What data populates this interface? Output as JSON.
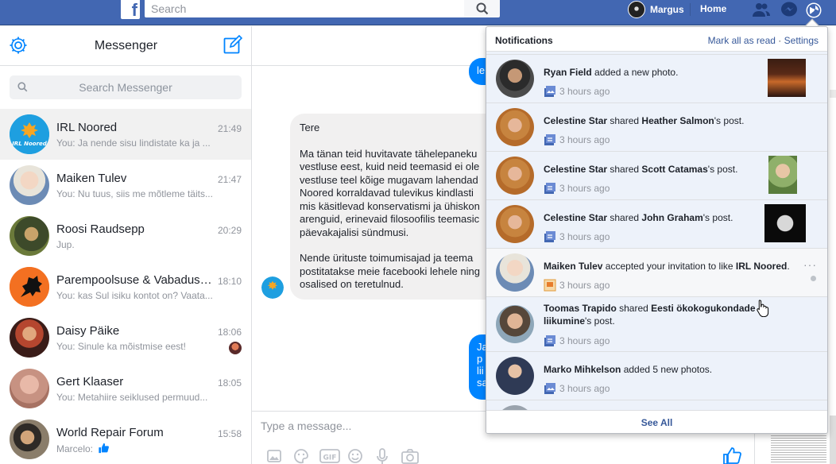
{
  "topbar": {
    "search_placeholder": "Search",
    "profile_name": "Margus",
    "home_label": "Home"
  },
  "messenger": {
    "title": "Messenger",
    "search_placeholder": "Search Messenger",
    "conversations": [
      {
        "name": "IRL Noored",
        "time": "21:49",
        "snippet": "You: Ja nende sisu lindistate ka ja ...",
        "avatar_icon": "irl-noored-logo"
      },
      {
        "name": "Maiken Tulev",
        "time": "21:47",
        "snippet": "You: Nu tuus, siis me mõtleme täits..."
      },
      {
        "name": "Roosi Raudsepp",
        "time": "20:29",
        "snippet": "Jup."
      },
      {
        "name": "Parempoolsuse & Vabaduse ...",
        "time": "18:10",
        "snippet": "You: kas Sul isiku kontot on? Vaata..."
      },
      {
        "name": "Daisy Päike",
        "time": "18:06",
        "snippet": "You: Sinule ka mõistmise eest!"
      },
      {
        "name": "Gert Klaaser",
        "time": "18:05",
        "snippet": "You: Metahiire seiklused permuud..."
      },
      {
        "name": "World Repair Forum",
        "time": "15:58",
        "snippet": "Marcelo:"
      }
    ]
  },
  "thread": {
    "out1": "le",
    "incoming": {
      "greeting": "Tere",
      "para1": "Ma tänan teid huvitavate tähelepaneku\nvestluse eest, kuid neid teemasid ei ole\nvestluse teel kõige mugavam lahendad\nNoored korraldavad tulevikus kindlasti\nmis käsitlevad konservatismi ja ühiskon\narenguid, erinevaid filosoofilis teemasic\npäevakajalisi sündmusi.",
      "para2": "Nende ürituste toimumisajad ja teema\npostitatakse meie facebooki lehele ning\nosalised on teretulnud."
    },
    "out2": "Ja\np\nlii\nsa",
    "composer_placeholder": "Type a message..."
  },
  "notifications": {
    "title": "Notifications",
    "mark_all": "Mark all as read",
    "separator": "·",
    "settings": "Settings",
    "see_all": "See All",
    "items": [
      {
        "actor": "Ryan Field",
        "pre": "",
        "verb": " added a new photo.",
        "obj": "",
        "post": "",
        "time": "3 hours ago"
      },
      {
        "actor": "Celestine Star",
        "verb": " shared ",
        "obj": "Heather Salmon",
        "post": "'s post.",
        "time": "3 hours ago"
      },
      {
        "actor": "Celestine Star",
        "verb": " shared ",
        "obj": "Scott Catamas",
        "post": "'s post.",
        "time": "3 hours ago"
      },
      {
        "actor": "Celestine Star",
        "verb": " shared ",
        "obj": "John Graham",
        "post": "'s post.",
        "time": "3 hours ago"
      },
      {
        "actor": "Maiken Tulev",
        "verb": " accepted your invitation to like ",
        "obj": "IRL Noored",
        "post": ".",
        "time": "3 hours ago"
      },
      {
        "actor": "Toomas Trapido",
        "verb": " shared ",
        "obj": "Eesti ökokogukondade liikumine",
        "post": "'s post.",
        "time": "3 hours ago"
      },
      {
        "actor": "Marko Mihkelson",
        "verb": " added 5 new photos.",
        "obj": "",
        "post": "",
        "time": "3 hours ago"
      }
    ]
  },
  "colors": {
    "brand": "#4267b2",
    "messenger_blue": "#0084ff",
    "link": "#365899"
  }
}
